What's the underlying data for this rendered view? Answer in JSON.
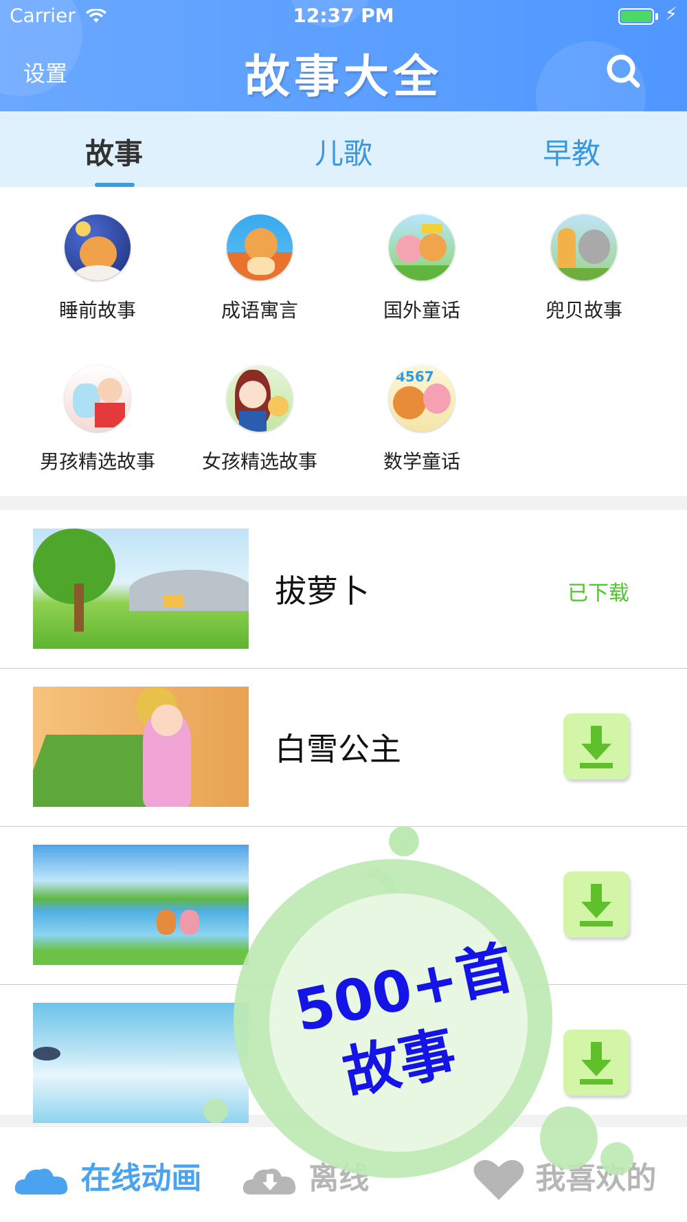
{
  "status_bar": {
    "carrier": "Carrier",
    "time": "12:37 PM"
  },
  "header": {
    "settings_label": "设置",
    "title": "故事大全"
  },
  "tabs": [
    {
      "label": "故事",
      "active": true
    },
    {
      "label": "儿歌",
      "active": false
    },
    {
      "label": "早教",
      "active": false
    }
  ],
  "categories": [
    {
      "label": "睡前故事",
      "icon": "bear-moon-icon"
    },
    {
      "label": "成语寓言",
      "icon": "bear-archer-icon"
    },
    {
      "label": "国外童话",
      "icon": "bear-king-icon"
    },
    {
      "label": "兜贝故事",
      "icon": "giraffe-koala-icon"
    },
    {
      "label": "男孩精选故事",
      "icon": "boy-robot-icon"
    },
    {
      "label": "女孩精选故事",
      "icon": "girl-cat-icon"
    },
    {
      "label": "数学童话",
      "icon": "numbers-bear-icon"
    }
  ],
  "stories": [
    {
      "title": "拔萝卜",
      "status": "已下载"
    },
    {
      "title": "白雪公主",
      "status": "download"
    },
    {
      "title": "",
      "status": "download"
    },
    {
      "title": "",
      "status": "download"
    }
  ],
  "promo": {
    "line1": "500+首",
    "line2": "故事"
  },
  "bottom_tabs": [
    {
      "label": "在线动画",
      "icon": "cloud-icon",
      "active": true
    },
    {
      "label": "离线",
      "icon": "cloud-download-icon",
      "active": false
    },
    {
      "label": "我喜欢的",
      "icon": "heart-icon",
      "active": false
    }
  ],
  "colors": {
    "header_blue": "#5aa0ff",
    "tab_bg": "#dff1fc",
    "downloaded_green": "#4cc82a",
    "promo_text": "#1414e6"
  }
}
